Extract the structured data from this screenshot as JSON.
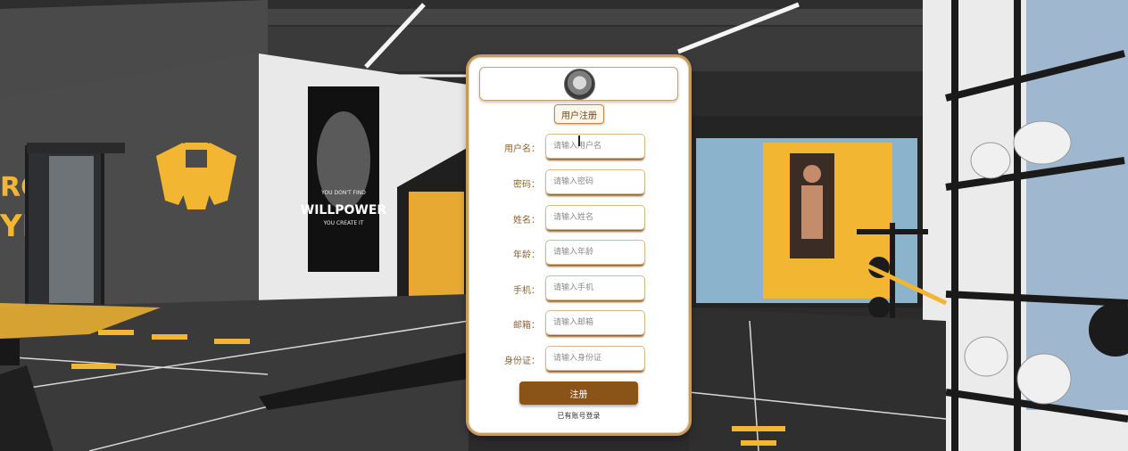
{
  "form": {
    "title_button": "用户注册",
    "fields": [
      {
        "label": "用户名：",
        "placeholder": "请输入用户名",
        "value": ""
      },
      {
        "label": "密码：",
        "placeholder": "请输入密码",
        "value": ""
      },
      {
        "label": "姓名：",
        "placeholder": "请输入姓名",
        "value": ""
      },
      {
        "label": "年龄：",
        "placeholder": "请输入年龄",
        "value": ""
      },
      {
        "label": "手机：",
        "placeholder": "请输入手机",
        "value": ""
      },
      {
        "label": "邮箱：",
        "placeholder": "请输入邮箱",
        "value": ""
      },
      {
        "label": "身份证：",
        "placeholder": "请输入身份证",
        "value": ""
      }
    ],
    "submit_label": "注册",
    "login_link": "已有账号登录"
  },
  "background": {
    "wall_sign_text_1": "RCLE",
    "wall_sign_text_2": "YM",
    "poster_text_1": "YOU DON'T FIND",
    "poster_text_2": "WILLPOWER",
    "poster_text_3": "YOU CREATE IT"
  },
  "colors": {
    "accent": "#8a5419",
    "card_border": "#c79a5e",
    "label": "#8a6332",
    "gym_yellow": "#f2b632"
  }
}
